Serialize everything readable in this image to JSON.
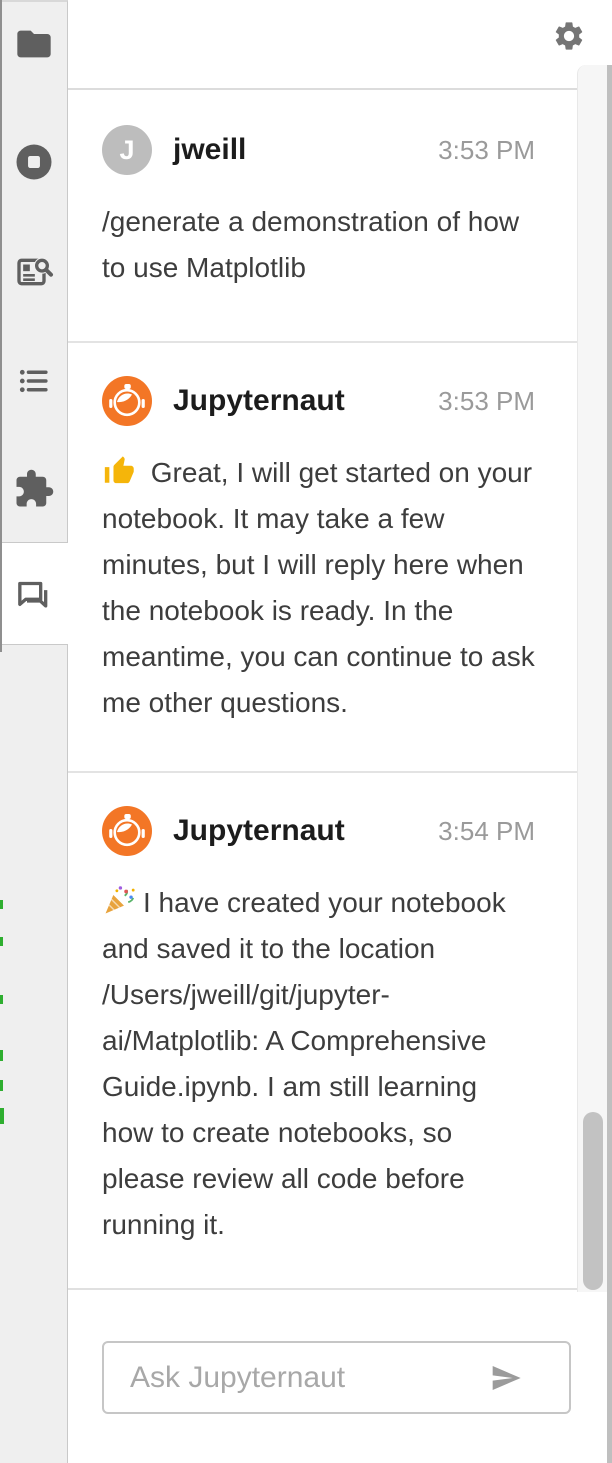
{
  "sidebar": {
    "tabs": [
      {
        "id": "file-browser",
        "icon": "folder-icon",
        "active": false
      },
      {
        "id": "running-sessions",
        "icon": "stop-circle-icon",
        "active": false
      },
      {
        "id": "inspector",
        "icon": "document-search-icon",
        "active": false
      },
      {
        "id": "table-of-contents",
        "icon": "list-icon",
        "active": false
      },
      {
        "id": "extensions",
        "icon": "puzzle-icon",
        "active": false
      },
      {
        "id": "chat",
        "icon": "chat-icon",
        "active": true
      }
    ]
  },
  "chat": {
    "header": {
      "settings_icon": "gear-icon"
    },
    "messages": [
      {
        "sender": "jweill",
        "avatar_type": "user",
        "avatar_letter": "J",
        "time": "3:53 PM",
        "emoji": null,
        "emoji_icon": null,
        "text": "/generate a demonstration of how to use Matplotlib"
      },
      {
        "sender": "Jupyternaut",
        "avatar_type": "bot",
        "avatar_letter": null,
        "time": "3:53 PM",
        "emoji": "👍",
        "emoji_icon": "thumbs-up",
        "text": "Great, I will get started on your notebook. It may take a few minutes, but I will reply here when the notebook is ready. In the meantime, you can continue to ask me other questions."
      },
      {
        "sender": "Jupyternaut",
        "avatar_type": "bot",
        "avatar_letter": null,
        "time": "3:54 PM",
        "emoji": "🎉",
        "emoji_icon": "party-popper",
        "text": "I have created your notebook and saved it to the location /Users/jweill/git/jupyter-ai/Matplotlib: A Comprehensive Guide.ipynb. I am still learning how to create notebooks, so please review all code before running it."
      }
    ],
    "input": {
      "placeholder": "Ask Jupyternaut",
      "send_icon": "send-icon"
    }
  },
  "colors": {
    "jupyter_orange": "#F37626",
    "user_avatar_gray": "#BDBDBD",
    "sidebar_icon_gray": "#5F5F5F",
    "timestamp_gray": "#9A9A9A",
    "scrollbar_thumb": "#C2C2C2",
    "edge_mark_green": "#2EAE2F"
  }
}
